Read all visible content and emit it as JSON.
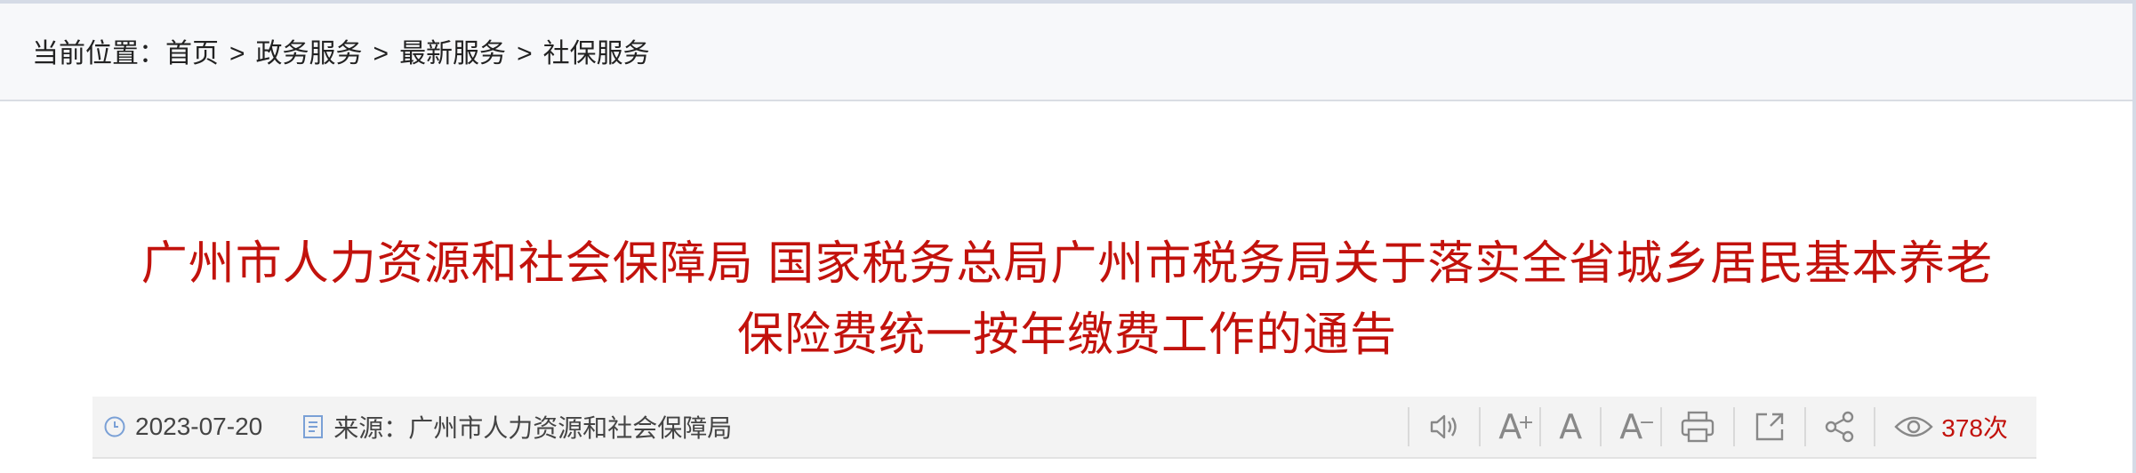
{
  "breadcrumb": {
    "label": "当前位置：",
    "items": [
      "首页",
      "政务服务",
      "最新服务",
      "社保服务"
    ],
    "separator": ">"
  },
  "article": {
    "title": "广州市人力资源和社会保障局 国家税务总局广州市税务局关于落实全省城乡居民基本养老保险费统一按年缴费工作的通告",
    "date": "2023-07-20",
    "source": "来源：广州市人力资源和社会保障局",
    "views": "378次"
  },
  "toolbar": {
    "icons": [
      "speaker-icon",
      "font-increase-icon",
      "font-normal-icon",
      "font-decrease-icon",
      "print-icon",
      "export-icon",
      "share-icon",
      "eye-icon"
    ],
    "font_large_glyph": "A",
    "font_large_sup": "+",
    "font_normal_glyph": "A",
    "font_small_glyph": "A",
    "font_small_sup": "−"
  },
  "colors": {
    "title": "#c2120c",
    "views": "#c2120c",
    "breadcrumb_bg": "#f7f8fa",
    "meta_bg": "#f3f3f3"
  }
}
